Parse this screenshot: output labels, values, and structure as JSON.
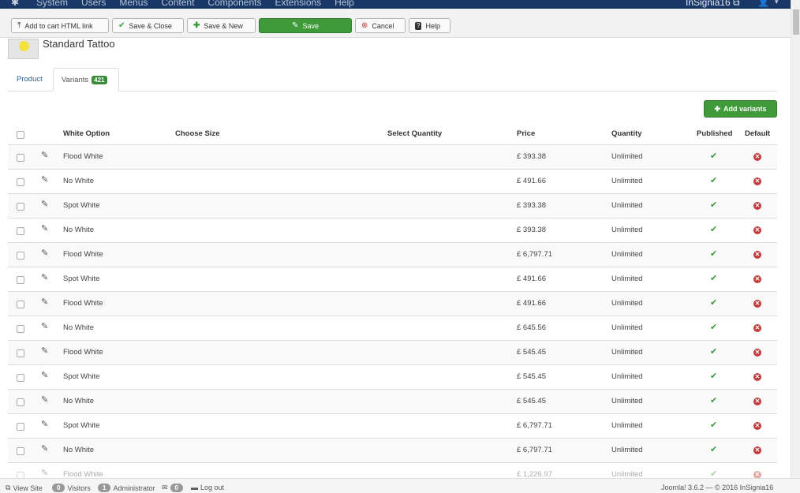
{
  "navbar": {
    "menu": [
      "System",
      "Users",
      "Menus",
      "Content",
      "Components",
      "Extensions",
      "Help"
    ],
    "site_name": "InSignia16 ⧉"
  },
  "toolbar": {
    "add_to_cart_label": "Add to cart HTML link",
    "save_close_label": "Save & Close",
    "save_new_label": "Save & New",
    "save_label": "Save",
    "cancel_label": "Cancel",
    "help_label": "Help"
  },
  "product": {
    "title": "Standard Tattoo"
  },
  "tabs": {
    "product_label": "Product",
    "variants_label": "Variants",
    "variants_count": "421"
  },
  "actions": {
    "add_variants_label": "Add variants"
  },
  "table": {
    "columns": {
      "white_option": "White Option",
      "choose_size": "Choose Size",
      "select_quantity": "Select Quantity",
      "price": "Price",
      "quantity": "Quantity",
      "published": "Published",
      "default": "Default"
    },
    "rows": [
      {
        "white_option": "Flood White",
        "price": "£ 393.38",
        "quantity": "Unlimited"
      },
      {
        "white_option": "No White",
        "price": "£ 491.66",
        "quantity": "Unlimited"
      },
      {
        "white_option": "Spot White",
        "price": "£ 393.38",
        "quantity": "Unlimited"
      },
      {
        "white_option": "No White",
        "price": "£ 393.38",
        "quantity": "Unlimited"
      },
      {
        "white_option": "Flood White",
        "price": "£ 6,797.71",
        "quantity": "Unlimited"
      },
      {
        "white_option": "Spot White",
        "price": "£ 491.66",
        "quantity": "Unlimited"
      },
      {
        "white_option": "Flood White",
        "price": "£ 491.66",
        "quantity": "Unlimited"
      },
      {
        "white_option": "No White",
        "price": "£ 645.56",
        "quantity": "Unlimited"
      },
      {
        "white_option": "Flood White",
        "price": "£ 545.45",
        "quantity": "Unlimited"
      },
      {
        "white_option": "Spot White",
        "price": "£ 545.45",
        "quantity": "Unlimited"
      },
      {
        "white_option": "No White",
        "price": "£ 545.45",
        "quantity": "Unlimited"
      },
      {
        "white_option": "Spot White",
        "price": "£ 6,797.71",
        "quantity": "Unlimited"
      },
      {
        "white_option": "No White",
        "price": "£ 6,797.71",
        "quantity": "Unlimited"
      },
      {
        "white_option": "Flood White",
        "price": "£ 1,226.97",
        "quantity": "Unlimited"
      }
    ]
  },
  "statusbar": {
    "view_site": "View Site",
    "visitors_count": "0",
    "visitors_label": "Visitors",
    "admin_count": "1",
    "admin_label": "Administrator",
    "messages_count": "0",
    "logout_label": "Log out",
    "footer": "Joomla! 3.6.2 — © 2016 InSignia16"
  },
  "colors": {
    "navbar": "#1a3867",
    "success": "#3f9a39",
    "published_check": "#3a9a3a",
    "default_x": "#c43a3a",
    "link": "#2a6496"
  }
}
